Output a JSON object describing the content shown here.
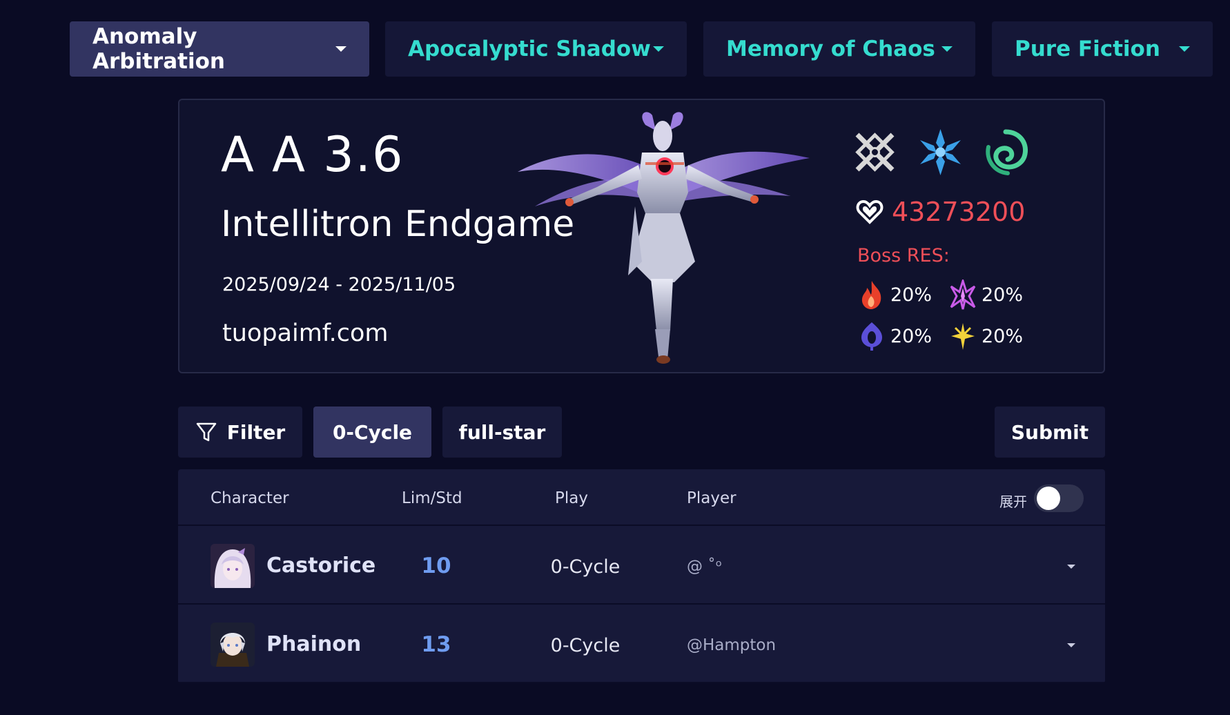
{
  "mode_tabs": [
    {
      "label": "Anomaly Arbitration",
      "active": true
    },
    {
      "label": "Apocalyptic Shadow",
      "active": false
    },
    {
      "label": "Memory of Chaos",
      "active": false
    },
    {
      "label": "Pure Fiction",
      "active": false
    }
  ],
  "stage": {
    "code": "A A 3.6",
    "name": "Intellitron Endgame",
    "dates": "2025/09/24 - 2025/11/05",
    "site": "tuopaimf.com",
    "weakness_icons": [
      "physical-icon",
      "ice-icon",
      "wind-icon"
    ],
    "hp": "43273200",
    "res_label": "Boss RES:",
    "resistances": [
      {
        "icon": "fire-icon",
        "value": "20%"
      },
      {
        "icon": "lightning-icon",
        "value": "20%"
      },
      {
        "icon": "quantum-icon",
        "value": "20%"
      },
      {
        "icon": "imaginary-icon",
        "value": "20%"
      }
    ]
  },
  "toolbar": {
    "filter_label": "Filter",
    "cycle_label": "0-Cycle",
    "fullstar_label": "full-star",
    "submit_label": "Submit"
  },
  "table": {
    "headers": {
      "character": "Character",
      "lim_std": "Lim/Std",
      "play": "Play",
      "player": "Player",
      "expand": "展开"
    },
    "rows": [
      {
        "character": "Castorice",
        "lim_std": "10",
        "play": "0-Cycle",
        "player": "@ ˚ᵒ"
      },
      {
        "character": "Phainon",
        "lim_std": "13",
        "play": "0-Cycle",
        "player": "@Hampton"
      }
    ]
  },
  "colors": {
    "background": "#0a0b24",
    "tab_accent": "#35dccf",
    "hp_red": "#ef4f58",
    "lim_blue": "#6f9cf0"
  }
}
